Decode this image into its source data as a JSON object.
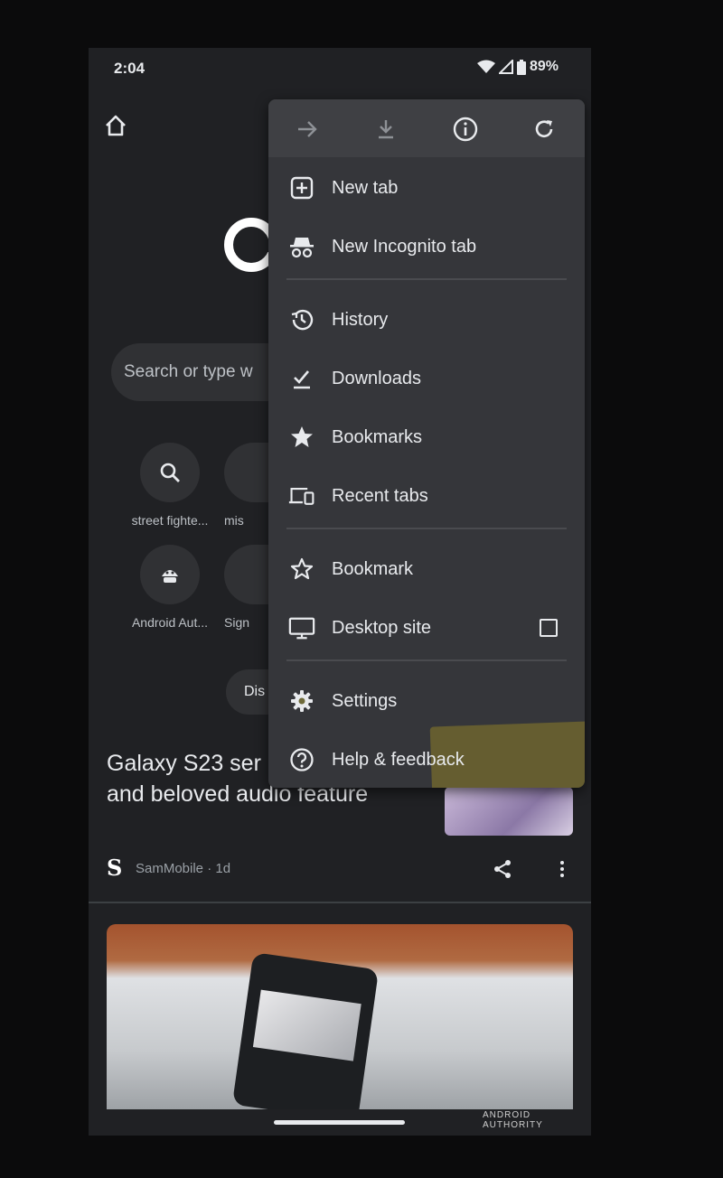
{
  "status_bar": {
    "time": "2:04",
    "battery": "89%"
  },
  "search": {
    "placeholder": "Search or type w"
  },
  "shortcuts": [
    {
      "label": "street fighte...",
      "icon": "search-icon"
    },
    {
      "label": "mis",
      "icon": "site-icon"
    },
    {
      "label": "Android Aut...",
      "icon": "android-authority-icon"
    },
    {
      "label": "Sign",
      "icon": "site-icon"
    }
  ],
  "discover": {
    "label": "Dis"
  },
  "article": {
    "title": "Galaxy S23 ser back an old and beloved audio feature",
    "source": "SamMobile · 1d",
    "source_logo": "S"
  },
  "watermark": "ANDROID AUTHORITY",
  "menu": {
    "toolbar": [
      "forward-icon",
      "download-icon",
      "info-icon",
      "refresh-icon"
    ],
    "items": [
      {
        "label": "New tab",
        "icon": "new-tab-icon"
      },
      {
        "label": "New Incognito tab",
        "icon": "incognito-icon"
      },
      {
        "label": "History",
        "icon": "history-icon"
      },
      {
        "label": "Downloads",
        "icon": "downloads-icon"
      },
      {
        "label": "Bookmarks",
        "icon": "bookmarks-icon"
      },
      {
        "label": "Recent tabs",
        "icon": "recent-tabs-icon"
      },
      {
        "label": "Bookmark",
        "icon": "bookmark-star-icon"
      },
      {
        "label": "Desktop site",
        "icon": "desktop-icon",
        "checked": false
      },
      {
        "label": "Settings",
        "icon": "gear-icon",
        "highlighted": true
      },
      {
        "label": "Help & feedback",
        "icon": "help-icon"
      }
    ]
  },
  "colors": {
    "background": "#202124",
    "menu": "#35363a",
    "highlight": "#8c7d28"
  }
}
